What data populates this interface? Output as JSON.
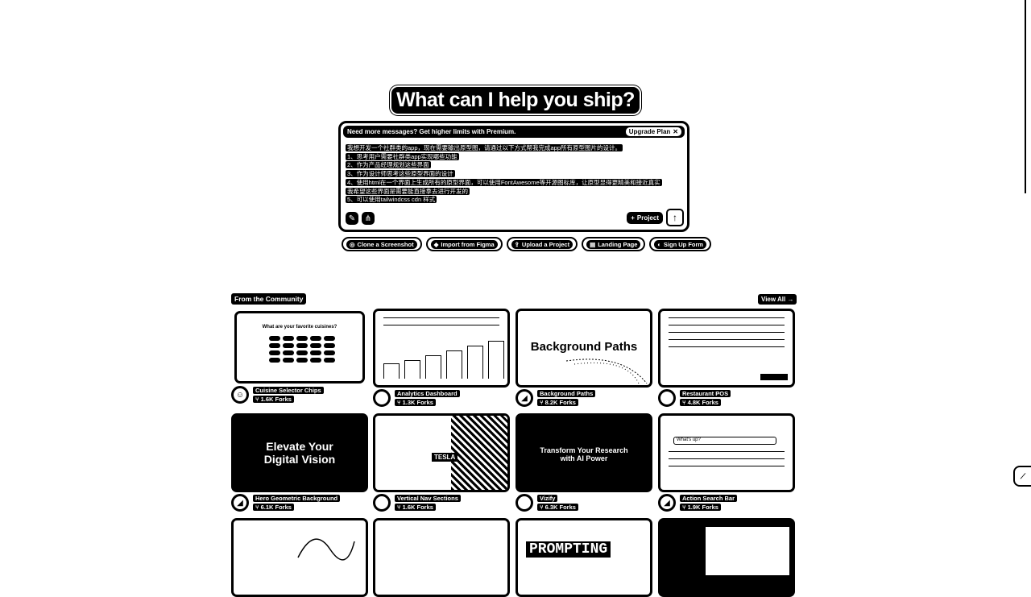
{
  "hero": {
    "title": "What can I help you ship?"
  },
  "prompt": {
    "upsell_text": "Need more messages? Get higher limits with Premium.",
    "upgrade_label": "Upgrade Plan",
    "lines": [
      "我想开发一个社群类的app，现在需要输出原型图，请通过以下方式帮我完成app所有原型图片的设计。",
      "1、思考用户需要社群类app实现哪些功能",
      "2、作为产品经理规划这些界面",
      "3、作为设计师思考这些原型界面的设计",
      "4、使用html在一个界面上生成所有的原型界面，可以使用FontAwesome等开源图标库，让原型显得更精美和接近真实",
      "我希望这些界面是需要能直接拿去进行开发的",
      "5、可以使用tailwindcss cdn 样式"
    ],
    "project_label": "Project"
  },
  "chips": [
    {
      "icon": "◎",
      "label": "Clone a Screenshot"
    },
    {
      "icon": "◆",
      "label": "Import from Figma"
    },
    {
      "icon": "⇪",
      "label": "Upload a Project"
    },
    {
      "icon": "▤",
      "label": "Landing Page"
    },
    {
      "icon": "◐",
      "label": "Sign Up Form"
    }
  ],
  "community": {
    "label": "From the Community",
    "view_all": "View All",
    "cards": [
      {
        "title": "Cuisine Selector Chips",
        "forks": "1.6K Forks",
        "thumb_text": "What are your favorite cuisines?"
      },
      {
        "title": "Analytics Dashboard",
        "forks": "1.3K Forks",
        "thumb_text": ""
      },
      {
        "title": "Background Paths",
        "forks": "8.2K Forks",
        "thumb_text": "Background Paths"
      },
      {
        "title": "Restaurant POS",
        "forks": "4.8K Forks",
        "thumb_text": ""
      },
      {
        "title": "Hero Geometric Background",
        "forks": "6.1K Forks",
        "thumb_text": "Elevate Your Digital Vision"
      },
      {
        "title": "Vertical Nav Sections",
        "forks": "1.6K Forks",
        "thumb_text": "TESLA"
      },
      {
        "title": "Vizify",
        "forks": "6.3K Forks",
        "thumb_text": "Transform Your Research with AI Power"
      },
      {
        "title": "Action Search Bar",
        "forks": "1.9K Forks",
        "thumb_text": "What's up?"
      },
      {
        "title": "",
        "forks": "",
        "thumb_text": ""
      },
      {
        "title": "",
        "forks": "",
        "thumb_text": ""
      },
      {
        "title": "",
        "forks": "",
        "thumb_text": "PROMPTING"
      },
      {
        "title": "",
        "forks": "",
        "thumb_text": ""
      }
    ]
  }
}
